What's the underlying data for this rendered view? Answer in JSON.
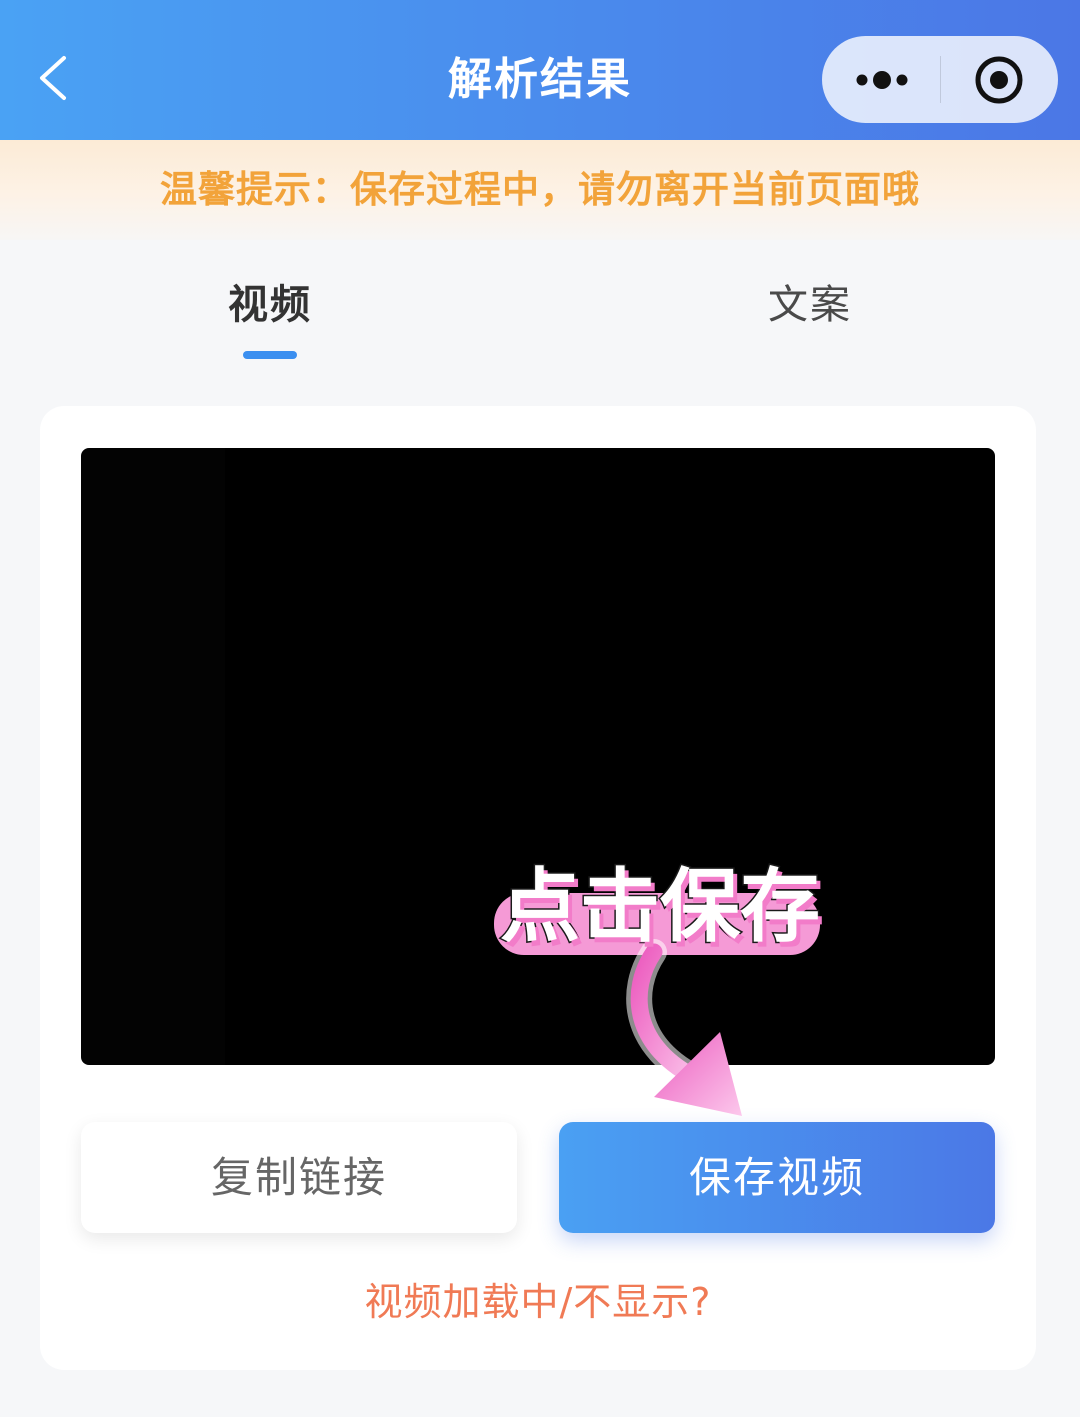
{
  "header": {
    "title": "解析结果",
    "back_icon": "chevron-left-icon",
    "more_icon": "more-dots-icon",
    "close_icon": "record-circle-icon"
  },
  "notice": {
    "text": "温馨提示：保存过程中，请勿离开当前页面哦"
  },
  "tabs": [
    {
      "label": "视频",
      "active": true
    },
    {
      "label": "文案",
      "active": false
    }
  ],
  "video": {
    "overlay_text": "点击保存",
    "overlay_icon": "curved-arrow-icon"
  },
  "actions": {
    "copy_label": "复制链接",
    "save_label": "保存视频"
  },
  "help_link": "视频加载中/不显示?",
  "colors": {
    "header_start": "#4aa2f4",
    "header_end": "#4b77e6",
    "notice_text": "#f2a33a",
    "tab_indicator": "#3b8ff0",
    "help_link": "#f07a55",
    "annotation_pink": "#f06bc5"
  }
}
